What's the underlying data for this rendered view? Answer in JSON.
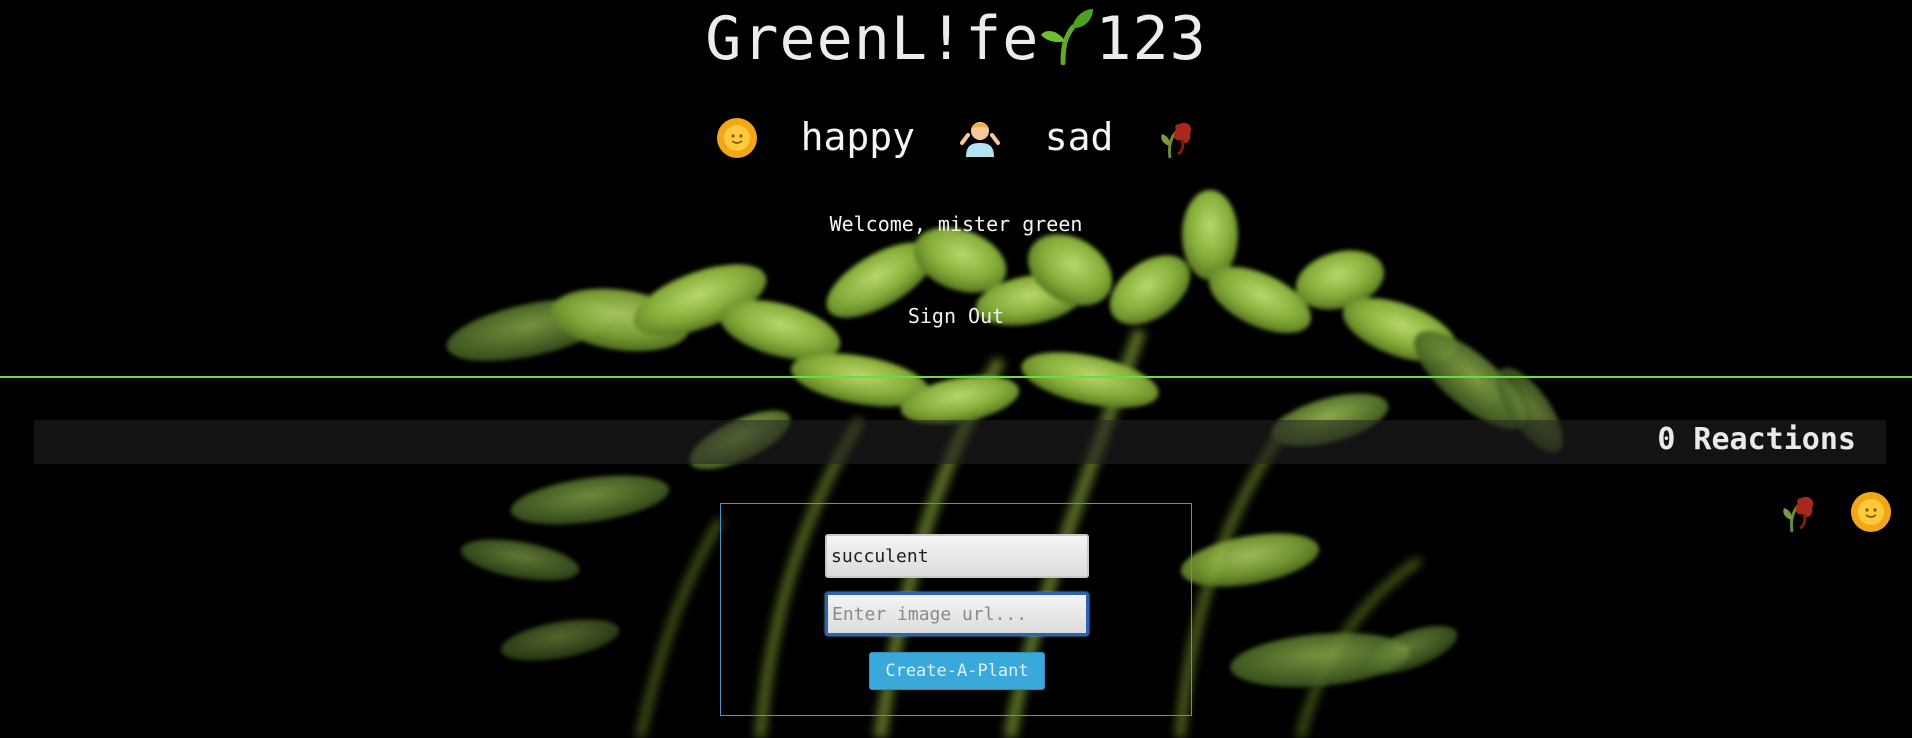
{
  "header": {
    "title": "GreenL!fe",
    "title_suffix": "123",
    "title_icon": "sprout-icon"
  },
  "mood": {
    "happy_icon": "sun-face-icon",
    "happy_label": "happy",
    "shrug_icon": "person-shrugging-icon",
    "sad_label": "sad",
    "sad_icon": "wilted-flower-icon"
  },
  "user": {
    "welcome_text": "Welcome, mister green",
    "sign_out_label": "Sign Out"
  },
  "reactions": {
    "count_label": "0 Reactions",
    "icons": [
      "wilted-flower-icon",
      "sun-face-icon"
    ]
  },
  "create_form": {
    "name_value": "succulent",
    "url_placeholder": "Enter image url...",
    "submit_label": "Create-A-Plant"
  },
  "colors": {
    "background": "#000000",
    "divider": "#6fd84a",
    "form_border": "#5a8fc4",
    "button": "#3aa8d8",
    "leaf": "#8fbf3e"
  }
}
